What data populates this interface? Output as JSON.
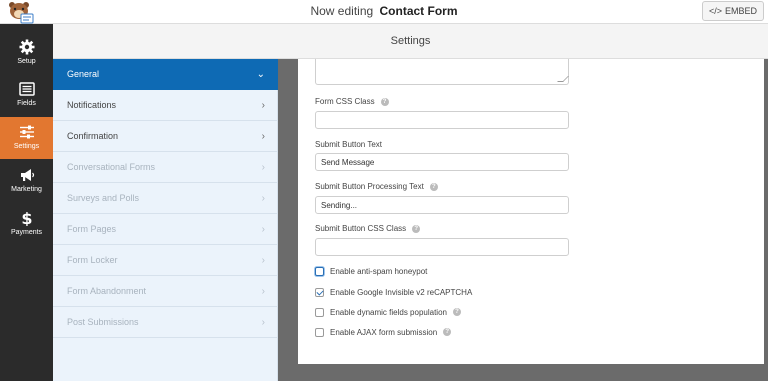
{
  "topbar": {
    "title_prefix": "Now editing",
    "form_name": "Contact Form",
    "embed_label": "EMBED",
    "embed_icon": "code-icon",
    "logo_icon": "wpforms-bear-logo"
  },
  "sidebar": {
    "items": [
      {
        "label": "Setup",
        "icon": "gear-icon"
      },
      {
        "label": "Fields",
        "icon": "list-icon"
      },
      {
        "label": "Settings",
        "icon": "sliders-icon",
        "active": true
      },
      {
        "label": "Marketing",
        "icon": "megaphone-icon"
      },
      {
        "label": "Payments",
        "icon": "dollar-icon"
      }
    ]
  },
  "settings_header": {
    "title": "Settings"
  },
  "nav": {
    "items": [
      {
        "label": "General",
        "state": "active"
      },
      {
        "label": "Notifications",
        "state": "enabled"
      },
      {
        "label": "Confirmation",
        "state": "enabled"
      },
      {
        "label": "Conversational Forms",
        "state": "disabled"
      },
      {
        "label": "Surveys and Polls",
        "state": "disabled"
      },
      {
        "label": "Form Pages",
        "state": "disabled"
      },
      {
        "label": "Form Locker",
        "state": "disabled"
      },
      {
        "label": "Form Abandonment",
        "state": "disabled"
      },
      {
        "label": "Post Submissions",
        "state": "disabled"
      }
    ]
  },
  "form": {
    "css_class": {
      "label": "Form CSS Class",
      "value": ""
    },
    "submit_text": {
      "label": "Submit Button Text",
      "value": "Send Message"
    },
    "processing_text": {
      "label": "Submit Button Processing Text",
      "value": "Sending..."
    },
    "submit_css": {
      "label": "Submit Button CSS Class",
      "value": ""
    },
    "checkboxes": [
      {
        "label": "Enable anti-spam honeypot",
        "checked": false,
        "focused": true,
        "help": false
      },
      {
        "label": "Enable Google Invisible v2 reCAPTCHA",
        "checked": true,
        "focused": false,
        "help": false
      },
      {
        "label": "Enable dynamic fields population",
        "checked": false,
        "focused": false,
        "help": true
      },
      {
        "label": "Enable AJAX form submission",
        "checked": false,
        "focused": false,
        "help": true
      }
    ]
  },
  "colors": {
    "accent_orange": "#e27730",
    "nav_active_blue": "#0e6ab4",
    "sidebar_dark": "#2b2b2b"
  }
}
